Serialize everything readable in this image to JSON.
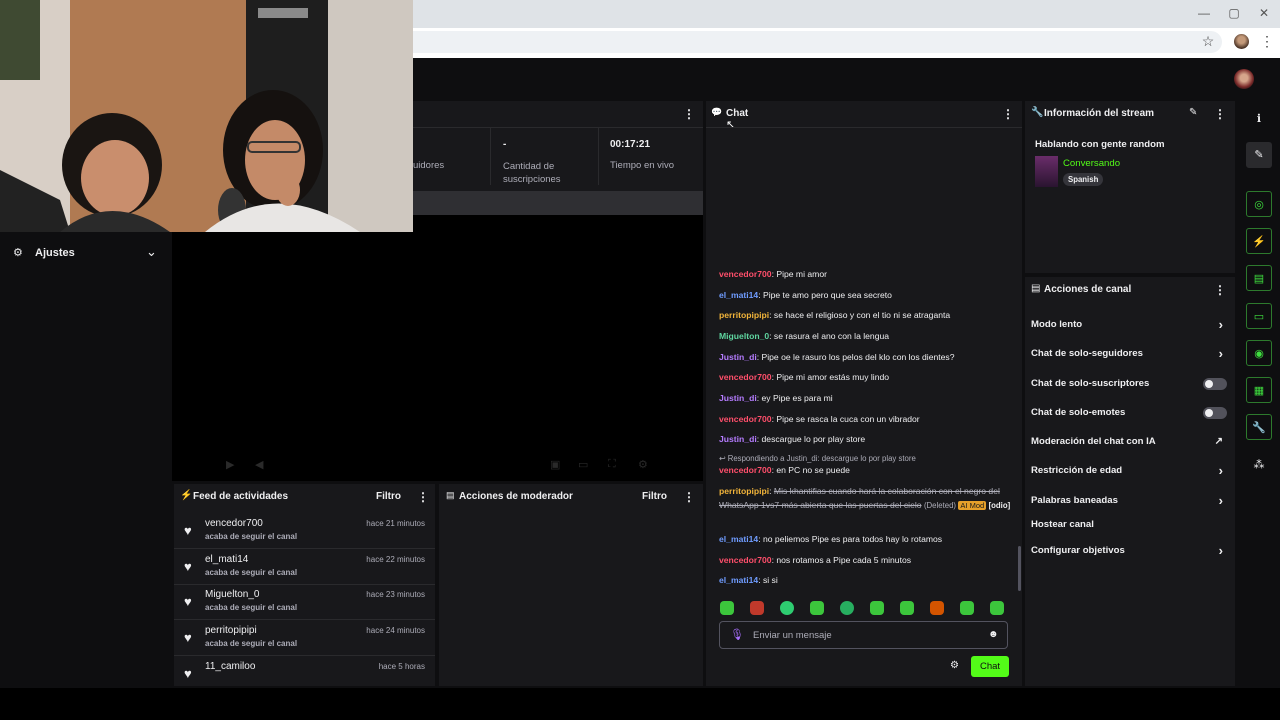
{
  "browser": {
    "minimize": "—",
    "maximize": "▢",
    "close": "✕"
  },
  "stats": {
    "followers_label": "uidores",
    "subs_value": "-",
    "subs_label": "Cantidad de suscripciones",
    "live_value": "00:17:21",
    "live_label": "Tiempo en vivo"
  },
  "settings": {
    "label": "Ajustes"
  },
  "feed": {
    "title": "Feed de actividades",
    "filter": "Filtro",
    "items": [
      {
        "user": "vencedor700",
        "time": "hace 21 minutos",
        "action": "acaba de seguir el canal"
      },
      {
        "user": "el_mati14",
        "time": "hace 22 minutos",
        "action": "acaba de seguir el canal"
      },
      {
        "user": "Miguelton_0",
        "time": "hace 23 minutos",
        "action": "acaba de seguir el canal"
      },
      {
        "user": "perritopipipi",
        "time": "hace 24 minutos",
        "action": "acaba de seguir el canal"
      },
      {
        "user": "11_camiloo",
        "time": "hace 5 horas",
        "action": ""
      }
    ]
  },
  "mod": {
    "title": "Acciones de moderador",
    "filter": "Filtro"
  },
  "chat": {
    "title": "Chat",
    "messages": [
      {
        "user": "vencedor700",
        "color": "#ff4f6b",
        "text": ": Pipe mi amor"
      },
      {
        "user": "el_mati14",
        "color": "#6f9cff",
        "text": ": Pipe te amo pero que sea secreto"
      },
      {
        "user": "perritopipipi",
        "color": "#f2b43a",
        "text": ": se hace el religioso y con el tio ni se atraganta"
      },
      {
        "user": "Miguelton_0",
        "color": "#5fd6a0",
        "text": ": se rasura el ano con la lengua"
      },
      {
        "user": "Justin_di",
        "color": "#b57cff",
        "text": ": Pipe oe le rasuro los pelos del klo con los dientes?"
      },
      {
        "user": "vencedor700",
        "color": "#ff4f6b",
        "text": ": Pipe mi amor estás muy lindo"
      },
      {
        "user": "Justin_di",
        "color": "#b57cff",
        "text": ": ey Pipe es para mi"
      },
      {
        "user": "vencedor700",
        "color": "#ff4f6b",
        "text": ": Pipe se rasca la cuca con un vibrador"
      },
      {
        "user": "Justin_di",
        "color": "#b57cff",
        "text": ": descargue lo por play store"
      }
    ],
    "reply_note": "Respondiendo a Justin_di: descargue lo por play store",
    "reply_msg": {
      "user": "vencedor700",
      "color": "#ff4f6b",
      "text": ": en PC no se puede"
    },
    "deleted_msg": {
      "user": "perritopipipi",
      "color": "#f2b43a",
      "text": "Mis khantifias cuando hará la colaboración con el negro del WhatsApp 1vs7 más abierta que las puertas del cielo",
      "deleted_label": "(Deleted)",
      "ai_badge": "AI Mod",
      "tag": "[odio]"
    },
    "tail": [
      {
        "user": "el_mati14",
        "color": "#6f9cff",
        "text": ": no peliemos Pipe es para todos hay lo rotamos"
      },
      {
        "user": "vencedor700",
        "color": "#ff4f6b",
        "text": ": nos rotamos a Pipe cada 5 minutos"
      },
      {
        "user": "el_mati14",
        "color": "#6f9cff",
        "text": ": si si"
      }
    ],
    "placeholder": "Enviar un mensaje",
    "send_label": "Chat"
  },
  "info": {
    "title": "Información del stream",
    "stream_title": "Hablando con gente random",
    "category": "Conversando",
    "language": "Spanish"
  },
  "actions": {
    "title": "Acciones de canal",
    "items": [
      {
        "label": "Modo lento"
      },
      {
        "label": "Chat de solo-seguidores"
      },
      {
        "label": "Chat de solo-suscriptores"
      },
      {
        "label": "Chat de solo-emotes"
      },
      {
        "label": "Moderación del chat con IA"
      },
      {
        "label": "Restricción de edad"
      },
      {
        "label": "Palabras baneadas"
      },
      {
        "label": "Hostear canal"
      },
      {
        "label": "Configurar objetivos"
      }
    ]
  },
  "colors": {
    "accent_green": "#53fc18",
    "panel": "#18181b",
    "background": "#0e0e10"
  }
}
